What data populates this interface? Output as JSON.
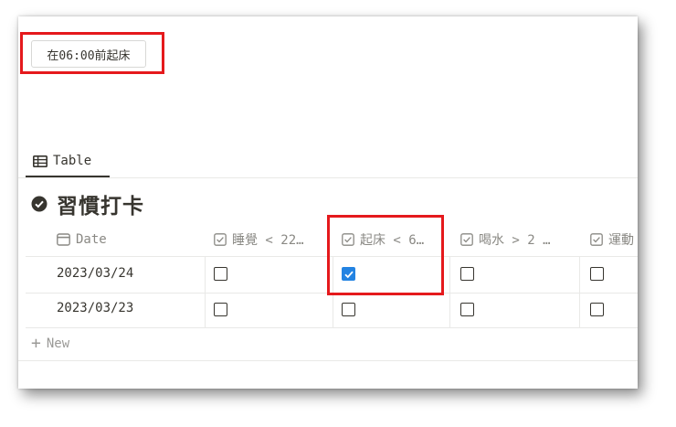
{
  "habit_tag": "在06:00前起床",
  "view_tab": {
    "label": "Table",
    "icon": "table-icon"
  },
  "database_title": "習慣打卡",
  "columns": [
    {
      "label": "Date",
      "icon": "calendar-icon"
    },
    {
      "label": "睡覺 < 22…",
      "icon": "checkbox-property-icon"
    },
    {
      "label": "起床 < 6…",
      "icon": "checkbox-property-icon"
    },
    {
      "label": "喝水 > 2 …",
      "icon": "checkbox-property-icon"
    },
    {
      "label": "運動",
      "icon": "checkbox-property-icon"
    }
  ],
  "rows": [
    {
      "date": "2023/03/24",
      "checks": [
        false,
        true,
        false,
        false
      ]
    },
    {
      "date": "2023/03/23",
      "checks": [
        false,
        false,
        false,
        false
      ]
    }
  ],
  "new_row_label": "New",
  "colors": {
    "highlight": "#e5191c",
    "checked": "#2383e2",
    "text": "#37352f",
    "muted": "#8a8984"
  }
}
